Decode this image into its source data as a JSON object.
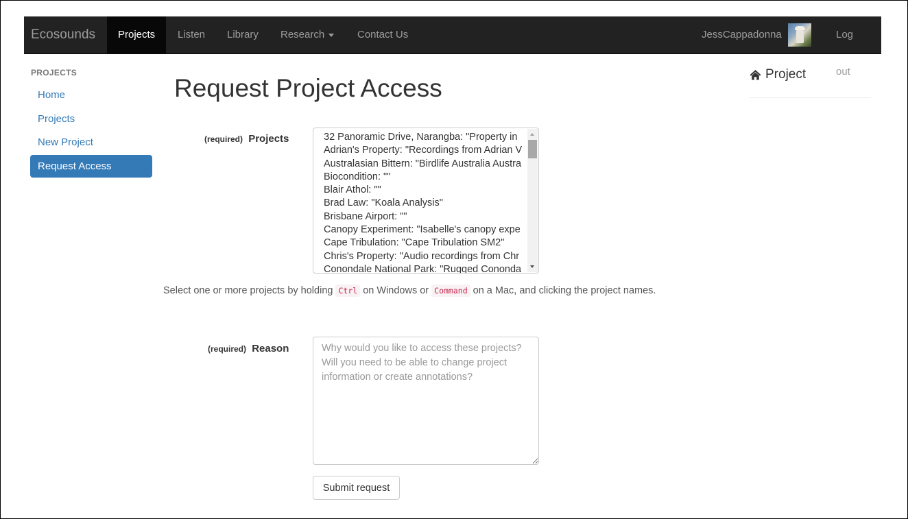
{
  "navbar": {
    "brand": "Ecosounds",
    "items": [
      {
        "label": "Projects",
        "active": true
      },
      {
        "label": "Listen"
      },
      {
        "label": "Library"
      },
      {
        "label": "Research"
      },
      {
        "label": "Contact Us"
      }
    ],
    "username": "JessCappadonna",
    "logout": "Log out"
  },
  "sidebar": {
    "header": "PROJECTS",
    "items": [
      {
        "label": "Home"
      },
      {
        "label": "Projects"
      },
      {
        "label": "New Project"
      },
      {
        "label": "Request Access",
        "active": true
      }
    ]
  },
  "main": {
    "title": "Request Project Access",
    "projects_field": {
      "required": "(required)",
      "label": "Projects",
      "options": [
        "32 Panoramic Drive, Narangba: \"Property in",
        "Adrian's Property: \"Recordings from Adrian V",
        "Australasian Bittern: \"Birdlife Australia Austra",
        "Biocondition: \"\"",
        "Blair Athol: \"\"",
        "Brad Law: \"Koala Analysis\"",
        "Brisbane Airport: \"\"",
        "Canopy Experiment: \"Isabelle's canopy expe",
        "Cape Tribulation: \"Cape Tribulation SM2\"",
        "Chris's Property: \"Audio recordings from Chr",
        "Conondale National Park: \"Rugged Cononda"
      ]
    },
    "help": {
      "before": "Select one or more projects by holding ",
      "key1": "Ctrl",
      "middle": " on Windows or ",
      "key2": "Command",
      "after": " on a Mac, and clicking the project names."
    },
    "reason_field": {
      "required": "(required)",
      "label": "Reason",
      "value": "",
      "placeholder": "Why would you like to access these projects? Will you need to be able to change project information or create annotations?"
    },
    "submit_label": "Submit request"
  },
  "right_panel": {
    "title": "Project",
    "icon": "home-icon"
  },
  "colors": {
    "navbar_bg": "#222222",
    "navbar_active_bg": "#080808",
    "link": "#337ab7",
    "code_text": "#c7254e",
    "code_bg": "#f9f2f4"
  }
}
